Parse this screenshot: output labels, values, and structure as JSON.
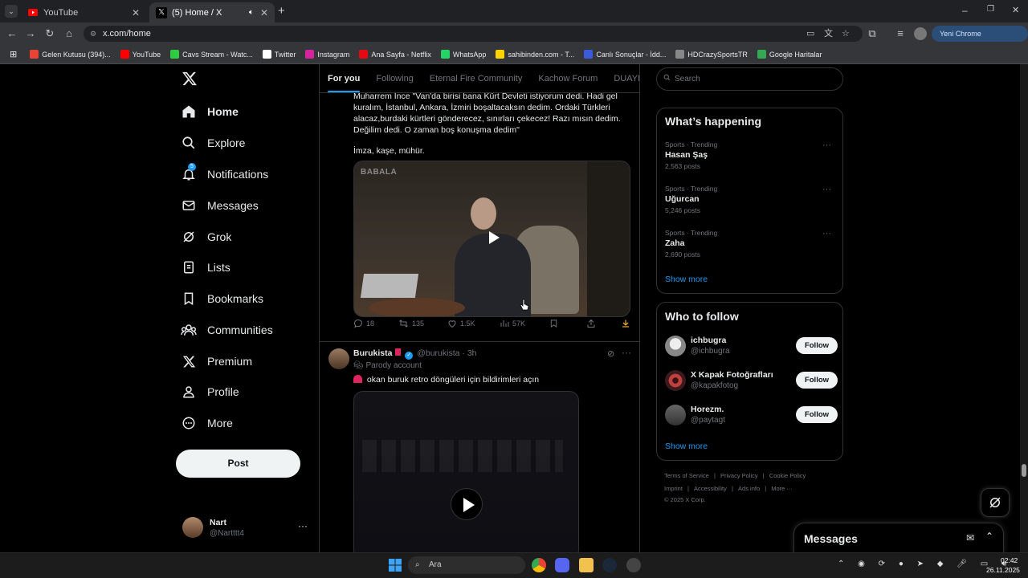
{
  "browser": {
    "tabs": [
      {
        "title": "YouTube",
        "active": false
      },
      {
        "title": "(5) Home / X",
        "active": true
      }
    ],
    "url": "x.com/home",
    "profile_button": "Yeni Chrome kullanılabilir",
    "bookmarks": [
      {
        "label": "Gelen Kutusu (394)...",
        "color": "#ea4335"
      },
      {
        "label": "YouTube",
        "color": "#ff0000"
      },
      {
        "label": "Cavs Stream - Watc...",
        "color": "#2ecc40"
      },
      {
        "label": "Twitter",
        "color": "#ffffff"
      },
      {
        "label": "Instagram",
        "color": "#d6249f"
      },
      {
        "label": "Ana Sayfa - Netflix",
        "color": "#e50914"
      },
      {
        "label": "WhatsApp",
        "color": "#25d366"
      },
      {
        "label": "sahibinden.com - T...",
        "color": "#ffd400"
      },
      {
        "label": "Canlı Sonuçlar - İdd...",
        "color": "#3b5bdb"
      },
      {
        "label": "HDCrazySportsTR",
        "color": "#888888"
      },
      {
        "label": "Google Haritalar",
        "color": "#34a853"
      }
    ]
  },
  "nav": {
    "items": [
      {
        "label": "Home",
        "icon": "home-icon"
      },
      {
        "label": "Explore",
        "icon": "search-icon"
      },
      {
        "label": "Notifications",
        "icon": "bell-icon",
        "badge": "5"
      },
      {
        "label": "Messages",
        "icon": "mail-icon"
      },
      {
        "label": "Grok",
        "icon": "grok-icon"
      },
      {
        "label": "Lists",
        "icon": "list-icon"
      },
      {
        "label": "Bookmarks",
        "icon": "bookmark-icon"
      },
      {
        "label": "Communities",
        "icon": "communities-icon"
      },
      {
        "label": "Premium",
        "icon": "x-logo-icon"
      },
      {
        "label": "Profile",
        "icon": "person-icon"
      },
      {
        "label": "More",
        "icon": "more-circle-icon"
      }
    ],
    "post_label": "Post",
    "account": {
      "name": "Nart",
      "handle": "@Nartttt4"
    }
  },
  "feed": {
    "tabs": [
      "For you",
      "Following",
      "Eternal Fire Community",
      "Kachow Forum",
      "DUAYENL"
    ],
    "tweet1": {
      "text_lines": [
        "Muharrem İnce \"Van'da birisi bana Kürt Devleti istiyorum dedi. Hadi gel",
        "kuralım, İstanbul, Ankara, İzmiri boşaltacaksın dedim. Ordaki Türkleri",
        "alacaz,burdaki kürtleri gönderecez, sınırları çekecez! Razı mısın dedim.",
        "Değilim dedi. O zaman boş konuşma dedim\""
      ],
      "text_tail": "İmza, kaşe, mühür.",
      "video_watermark": "BABALA",
      "replies": "18",
      "reposts": "135",
      "likes": "1.5K",
      "views": "57K"
    },
    "tweet2": {
      "name": "Burukista",
      "handle": "@burukista",
      "time": "3h",
      "label": "Parody account",
      "text": "okan buruk retro döngüleri için bildirimleri açın"
    }
  },
  "sidebar": {
    "search_placeholder": "Search",
    "happening_title": "What’s happening",
    "trends": [
      {
        "meta": "Sports · Trending",
        "name": "Hasan Şaş",
        "count": "2,563 posts"
      },
      {
        "meta": "Sports · Trending",
        "name": "Uğurcan",
        "count": "5,246 posts"
      },
      {
        "meta": "Sports · Trending",
        "name": "Zaha",
        "count": "2,690 posts"
      }
    ],
    "show_more": "Show more",
    "who_to_follow_title": "Who to follow",
    "follow_suggestions": [
      {
        "name": "ichbugra",
        "handle": "@ichbugra"
      },
      {
        "name": "X Kapak Fotoğrafları",
        "handle": "@kapakfotog"
      },
      {
        "name": "Horezm.",
        "handle": "@paytagt"
      }
    ],
    "follow_label": "Follow",
    "footer_line1": [
      "Terms of Service",
      "Privacy Policy",
      "Cookie Policy"
    ],
    "footer_line2": [
      "Imprint",
      "Accessibility",
      "Ads info",
      "More ···"
    ],
    "copyright": "© 2025 X Corp."
  },
  "messages_drawer": {
    "title": "Messages"
  },
  "taskbar": {
    "search_label": "Ara",
    "time": "02:42",
    "date": "26.11.2025"
  }
}
